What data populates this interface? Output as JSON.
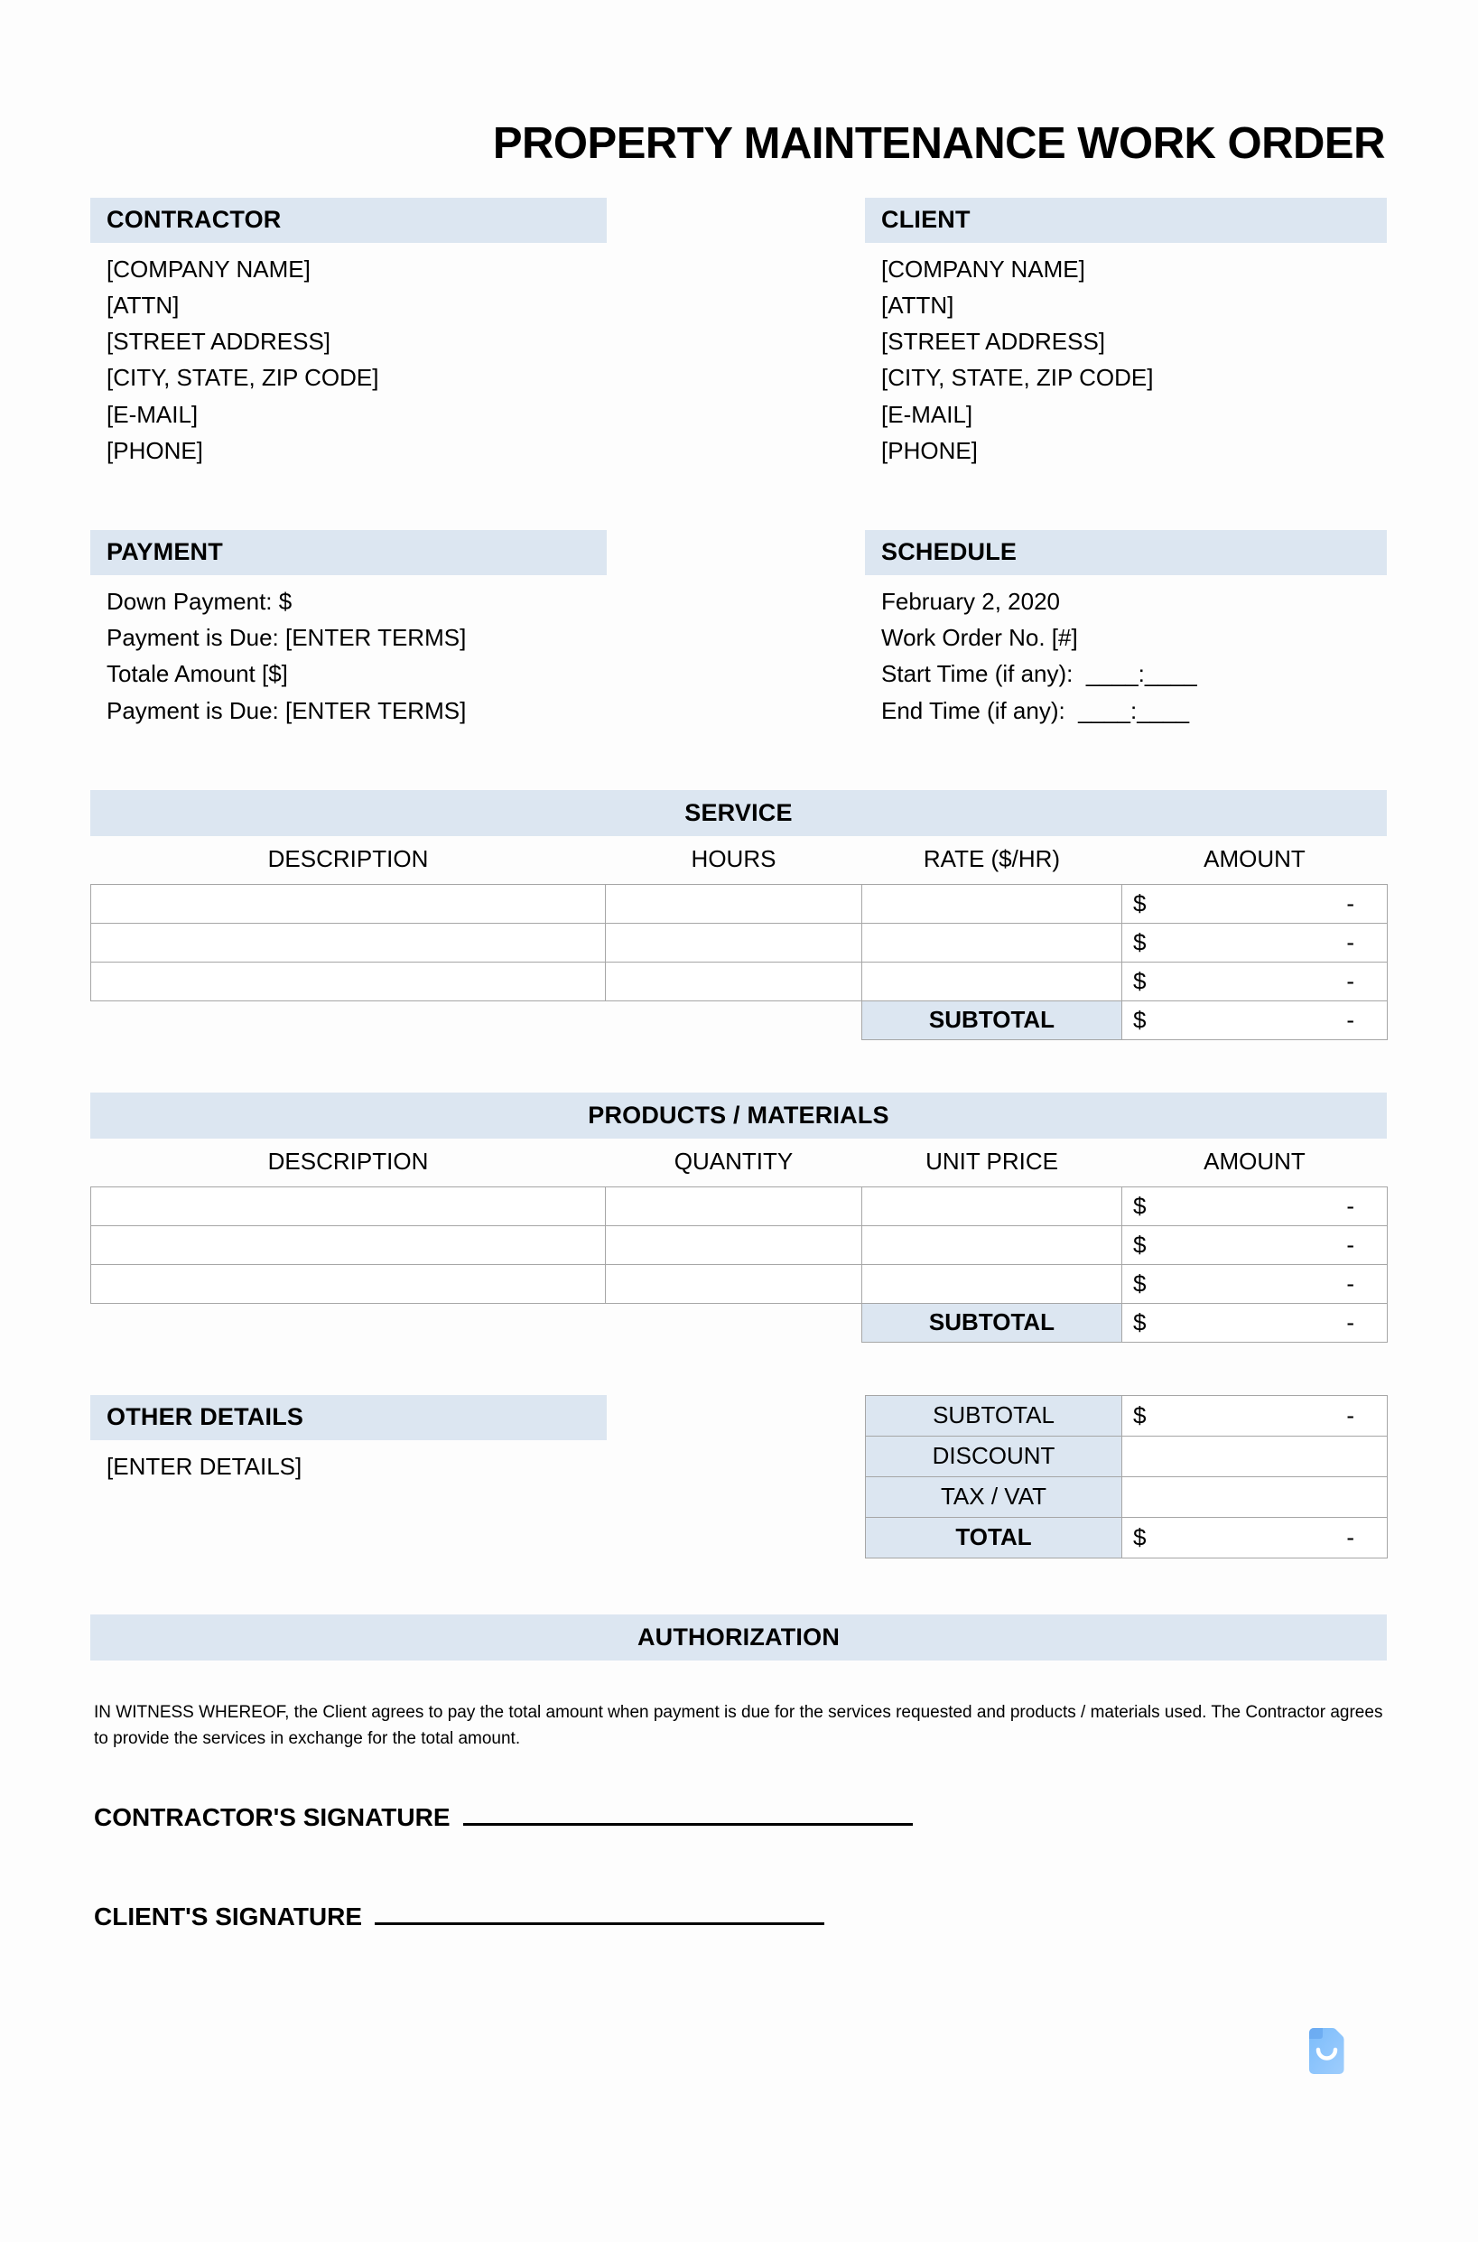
{
  "document": {
    "title": "PROPERTY MAINTENANCE WORK ORDER"
  },
  "contractor": {
    "heading": "CONTRACTOR",
    "lines": [
      "[COMPANY NAME]",
      "[ATTN]",
      "[STREET ADDRESS]",
      "[CITY, STATE, ZIP CODE]",
      "[E-MAIL]",
      "[PHONE]"
    ]
  },
  "client": {
    "heading": "CLIENT",
    "lines": [
      "[COMPANY NAME]",
      "[ATTN]",
      "[STREET ADDRESS]",
      "[CITY, STATE, ZIP CODE]",
      "[E-MAIL]",
      "[PHONE]"
    ]
  },
  "payment": {
    "heading": "PAYMENT",
    "lines": [
      "Down Payment: $",
      "Payment is Due: [ENTER TERMS]",
      "Totale Amount [$]",
      "Payment is Due: [ENTER TERMS]"
    ]
  },
  "schedule": {
    "heading": "SCHEDULE",
    "lines": [
      "February 2, 2020",
      "Work Order No. [#]",
      "Start Time (if any):  ____:____",
      "End Time (if any):  ____:____"
    ]
  },
  "service_table": {
    "heading": "SERVICE",
    "columns": [
      "DESCRIPTION",
      "HOURS",
      "RATE ($/HR)",
      "AMOUNT"
    ],
    "rows": [
      {
        "description": "",
        "hours": "",
        "rate": "",
        "amount_currency": "$",
        "amount_value": "-"
      },
      {
        "description": "",
        "hours": "",
        "rate": "",
        "amount_currency": "$",
        "amount_value": "-"
      },
      {
        "description": "",
        "hours": "",
        "rate": "",
        "amount_currency": "$",
        "amount_value": "-"
      }
    ],
    "subtotal_label": "SUBTOTAL",
    "subtotal_currency": "$",
    "subtotal_value": "-"
  },
  "products_table": {
    "heading": "PRODUCTS / MATERIALS",
    "columns": [
      "DESCRIPTION",
      "QUANTITY",
      "UNIT PRICE",
      "AMOUNT"
    ],
    "rows": [
      {
        "description": "",
        "quantity": "",
        "unit_price": "",
        "amount_currency": "$",
        "amount_value": "-"
      },
      {
        "description": "",
        "quantity": "",
        "unit_price": "",
        "amount_currency": "$",
        "amount_value": "-"
      },
      {
        "description": "",
        "quantity": "",
        "unit_price": "",
        "amount_currency": "$",
        "amount_value": "-"
      }
    ],
    "subtotal_label": "SUBTOTAL",
    "subtotal_currency": "$",
    "subtotal_value": "-"
  },
  "other_details": {
    "heading": "OTHER DETAILS",
    "placeholder": "[ENTER DETAILS]"
  },
  "totals": {
    "rows": [
      {
        "label": "SUBTOTAL",
        "currency": "$",
        "value": "-",
        "bold": false
      },
      {
        "label": "DISCOUNT",
        "currency": "",
        "value": "",
        "bold": false
      },
      {
        "label": "TAX / VAT",
        "currency": "",
        "value": "",
        "bold": false
      },
      {
        "label": "TOTAL",
        "currency": "$",
        "value": "-",
        "bold": true
      }
    ]
  },
  "authorization": {
    "heading": "AUTHORIZATION",
    "witness_text": "IN WITNESS WHEREOF, the Client agrees to pay the total amount when payment is due for the services requested and products / materials used. The Contractor agrees to provide the services in exchange for the total amount.",
    "contractor_signature_label": "CONTRACTOR'S SIGNATURE",
    "client_signature_label": "CLIENT'S SIGNATURE"
  },
  "colors": {
    "band_blue": "#dce6f1",
    "border_gray": "#a6a6a6",
    "watermark_blue": "#6fb3f7",
    "page_background": "#fdfdfd"
  }
}
